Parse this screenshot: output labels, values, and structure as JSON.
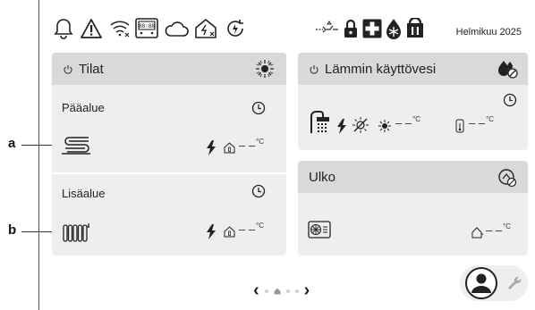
{
  "callouts": [
    "a",
    "b"
  ],
  "statusbar": {
    "date": "Helmikuu 2025",
    "left_icons": [
      "bell-icon",
      "warning-icon",
      "wifi-off-icon",
      "controller-icon",
      "cloud-icon",
      "home-smart-icon",
      "sync-icon"
    ],
    "right_icons": [
      "external-input-icon",
      "lock-icon",
      "emergency-icon",
      "defrost-icon",
      "silent-mode-icon"
    ]
  },
  "rooms_card": {
    "title": "Tilat",
    "header_icon": "sun-icon",
    "main_zone": {
      "name": "Pääalue",
      "emitter_icon": "underfloor-heating-icon",
      "temperature": "– –",
      "unit": "°C"
    },
    "additional_zone": {
      "name": "Lisäalue",
      "emitter_icon": "radiator-icon",
      "temperature": "– –",
      "unit": "°C"
    }
  },
  "dhw_card": {
    "title": "Lämmin käyttövesi",
    "header_icon": "dhw-off-icon",
    "temperature_1": "– –",
    "temperature_2": "– –",
    "unit": "°C"
  },
  "outdoor_card": {
    "title": "Ulko",
    "header_icon": "outdoor-off-icon",
    "temperature": "– –",
    "unit": "°C"
  },
  "pager": {
    "prev": "‹",
    "next": "›",
    "pages": 4,
    "current_page_icon": "home-icon"
  },
  "nav": {
    "user_icon": "user-icon",
    "settings_icon": "wrench-icon"
  }
}
